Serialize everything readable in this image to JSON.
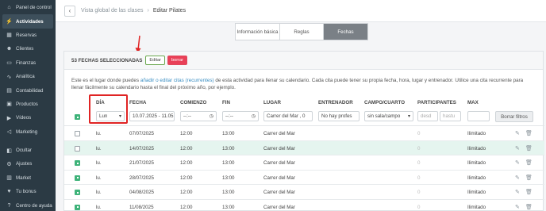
{
  "sidebar": {
    "items": [
      {
        "label": "Panel de control",
        "icon": "home-icon",
        "glyph": "⌂"
      },
      {
        "label": "Actividades",
        "icon": "activity-icon",
        "glyph": "⚡",
        "active": true
      },
      {
        "label": "Reservas",
        "icon": "calendar-icon",
        "glyph": "▦"
      },
      {
        "label": "Clientes",
        "icon": "users-icon",
        "glyph": "☻"
      },
      {
        "label": "Finanzas",
        "icon": "money-icon",
        "glyph": "▭"
      },
      {
        "label": "Analítica",
        "icon": "chart-icon",
        "glyph": "∿"
      },
      {
        "label": "Contabilidad",
        "icon": "ledger-icon",
        "glyph": "▤"
      },
      {
        "label": "Productos",
        "icon": "box-icon",
        "glyph": "▣"
      },
      {
        "label": "Vídeos",
        "icon": "video-icon",
        "glyph": "▶"
      },
      {
        "label": "Marketing",
        "icon": "megaphone-icon",
        "glyph": "◁"
      },
      {
        "label": "Ocultar",
        "icon": "hide-icon",
        "glyph": "◧"
      },
      {
        "label": "Ajustes",
        "icon": "gear-icon",
        "glyph": "⚙"
      },
      {
        "label": "Market",
        "icon": "store-icon",
        "glyph": "▥"
      },
      {
        "label": "Tu bonus",
        "icon": "heart-icon",
        "glyph": "♥"
      },
      {
        "label": "Centro de ayuda",
        "icon": "help-icon",
        "glyph": "?"
      }
    ]
  },
  "breadcrumb": {
    "parent": "Vista global de las clases",
    "separator": "›",
    "current": "Editar Pilates"
  },
  "tabs": [
    {
      "label": "Información básica",
      "active": false
    },
    {
      "label": "Reglas",
      "active": false
    },
    {
      "label": "Fechas",
      "active": true
    }
  ],
  "panel": {
    "selected_count": "53 FECHAS SELECCIONADAS",
    "edit_label": "Editar",
    "delete_label": "borrar",
    "desc_before": "Este es el lugar donde puedes ",
    "desc_link": "añadir o editar citas (recurrentes)",
    "desc_after": " de esta actividad para llenar su calendario. Cada cita puede tener su propia fecha, hora, lugar y entrenador. Utilice una cita recurrente para llenar fácilmente su calendario hasta el final del próximo año, por ejemplo."
  },
  "table": {
    "headers": {
      "day": "DÍA",
      "date": "FECHA",
      "start": "COMIENZO",
      "end": "FIN",
      "place": "LUGAR",
      "trainer": "ENTRENADOR",
      "field": "CAMPO/CUARTO",
      "participants": "PARTICIPANTES",
      "max": "MAX"
    },
    "filters": {
      "day_value": "Lun",
      "date_value": "10.07.2025 - 11.05",
      "start_value": "--:--",
      "end_value": "--:--",
      "place_value": "Carrer del Mar , 0",
      "trainer_value": "No hay profes",
      "field_value": "sin sala/campo",
      "participants_from": "desd",
      "participants_to": "hastu",
      "clear_label": "Borrar filtros"
    },
    "rows": [
      {
        "checked": false,
        "highlight": false,
        "day": "lu.",
        "date": "07/07/2025",
        "start": "12:00",
        "end": "13:00",
        "place": "Carrer del Mar",
        "participants": "0",
        "max": "Ilimitado"
      },
      {
        "checked": false,
        "highlight": true,
        "day": "lu.",
        "date": "14/07/2025",
        "start": "12:00",
        "end": "13:00",
        "place": "Carrer del Mar",
        "participants": "0",
        "max": "Ilimitado"
      },
      {
        "checked": true,
        "highlight": false,
        "day": "lu.",
        "date": "21/07/2025",
        "start": "12:00",
        "end": "13:00",
        "place": "Carrer del Mar",
        "participants": "0",
        "max": "Ilimitado"
      },
      {
        "checked": true,
        "highlight": false,
        "day": "lu.",
        "date": "28/07/2025",
        "start": "12:00",
        "end": "13:00",
        "place": "Carrer del Mar",
        "participants": "0",
        "max": "Ilimitado"
      },
      {
        "checked": true,
        "highlight": false,
        "day": "lu.",
        "date": "04/08/2025",
        "start": "12:00",
        "end": "13:00",
        "place": "Carrer del Mar",
        "participants": "0",
        "max": "Ilimitado"
      },
      {
        "checked": true,
        "highlight": false,
        "day": "lu.",
        "date": "11/08/2025",
        "start": "12:00",
        "end": "13:00",
        "place": "Carrer del Mar",
        "participants": "0",
        "max": "Ilimitado"
      }
    ]
  },
  "colors": {
    "sidebar_bg": "#2b3a44",
    "accent_green": "#3fb37a",
    "danger": "#e94057",
    "annotation_red": "#e02424",
    "link": "#3a8ec2"
  }
}
